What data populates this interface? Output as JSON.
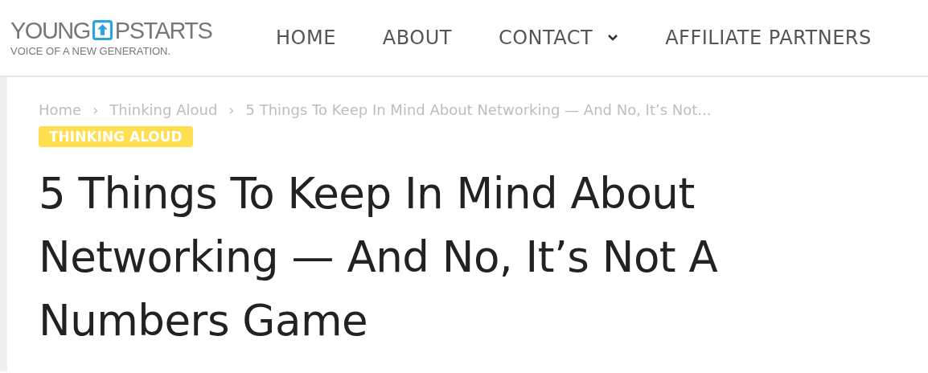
{
  "logo": {
    "text_before_icon": "YOUNG",
    "text_after_icon": "PSTARTS",
    "tagline": "VOICE OF A NEW GENERATION."
  },
  "nav": [
    {
      "label": "HOME",
      "has_dropdown": false
    },
    {
      "label": "ABOUT",
      "has_dropdown": false
    },
    {
      "label": "CONTACT",
      "has_dropdown": true
    },
    {
      "label": "AFFILIATE PARTNERS",
      "has_dropdown": false
    }
  ],
  "breadcrumb": {
    "items": [
      "Home",
      "Thinking Aloud",
      "5 Things To Keep In Mind About Networking — And No, It’s Not..."
    ],
    "separator": "›"
  },
  "category_tag": "THINKING ALOUD",
  "article_title": "5 Things To Keep In Mind About Networking — And No, It’s Not A Numbers Game"
}
